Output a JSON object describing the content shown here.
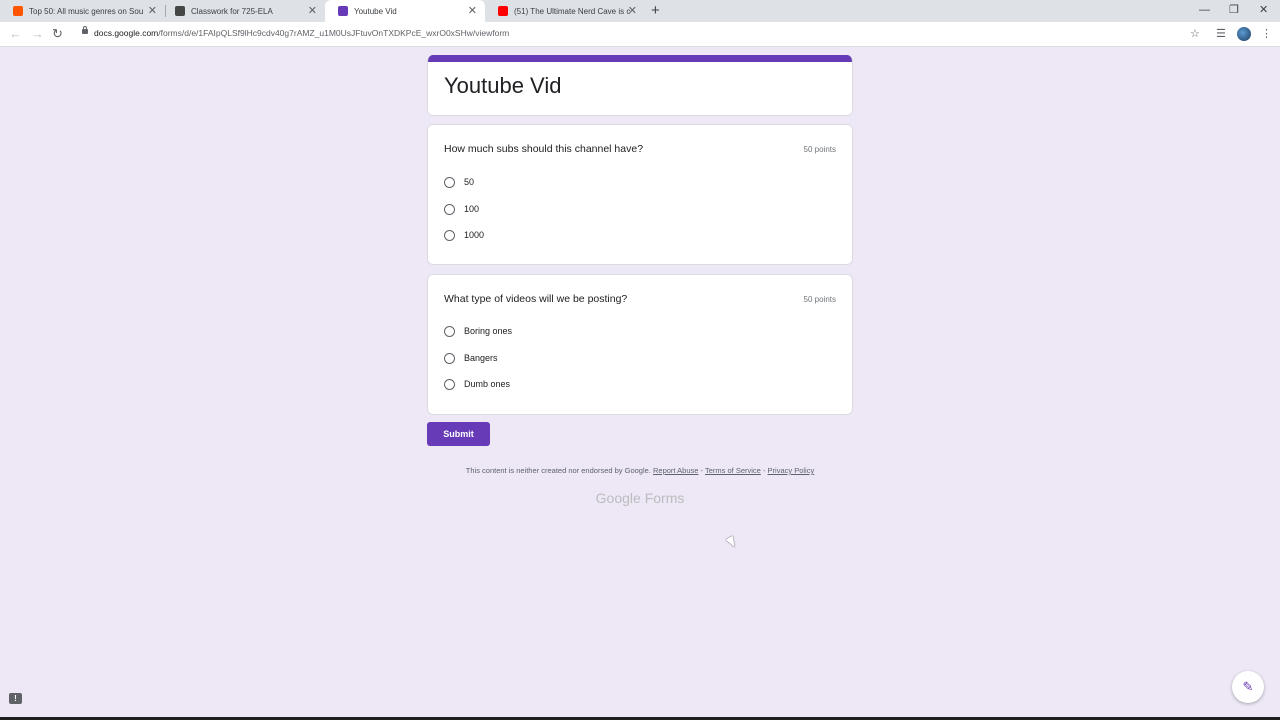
{
  "tabs": [
    {
      "title": "Top 50: All music genres on Sou",
      "favicon_color": "#ff5500"
    },
    {
      "title": "Classwork for 725-ELA",
      "favicon_color": "#444746"
    },
    {
      "title": "Youtube Vid",
      "favicon_color": "#673ab7",
      "active": true
    },
    {
      "title": "(51) The Ultimate Nerd Cave is c",
      "favicon_color": "#ff0000"
    }
  ],
  "toolbar": {
    "url_domain": "docs.google.com",
    "url_path": "/forms/d/e/1FAIpQLSf9lHc9cdv40g7rAMZ_u1M0UsJFtuvOnTXDKPcE_wxrO0xSHw/viewform"
  },
  "form": {
    "title": "Youtube Vid",
    "accent_color": "#673ab7",
    "questions": [
      {
        "title": "How much subs should this channel have?",
        "points": "50 points",
        "options": [
          "50",
          "100",
          "1000"
        ]
      },
      {
        "title": "What type of videos will we be posting?",
        "points": "50 points",
        "options": [
          "Boring ones",
          "Bangers",
          "Dumb ones"
        ]
      }
    ],
    "submit_label": "Submit"
  },
  "footer": {
    "disclaimer": "This content is neither created nor endorsed by Google.",
    "report_abuse": "Report Abuse",
    "terms": "Terms of Service",
    "privacy": "Privacy Policy",
    "sep": "-",
    "brand_google": "Google",
    "brand_forms": "Forms"
  }
}
